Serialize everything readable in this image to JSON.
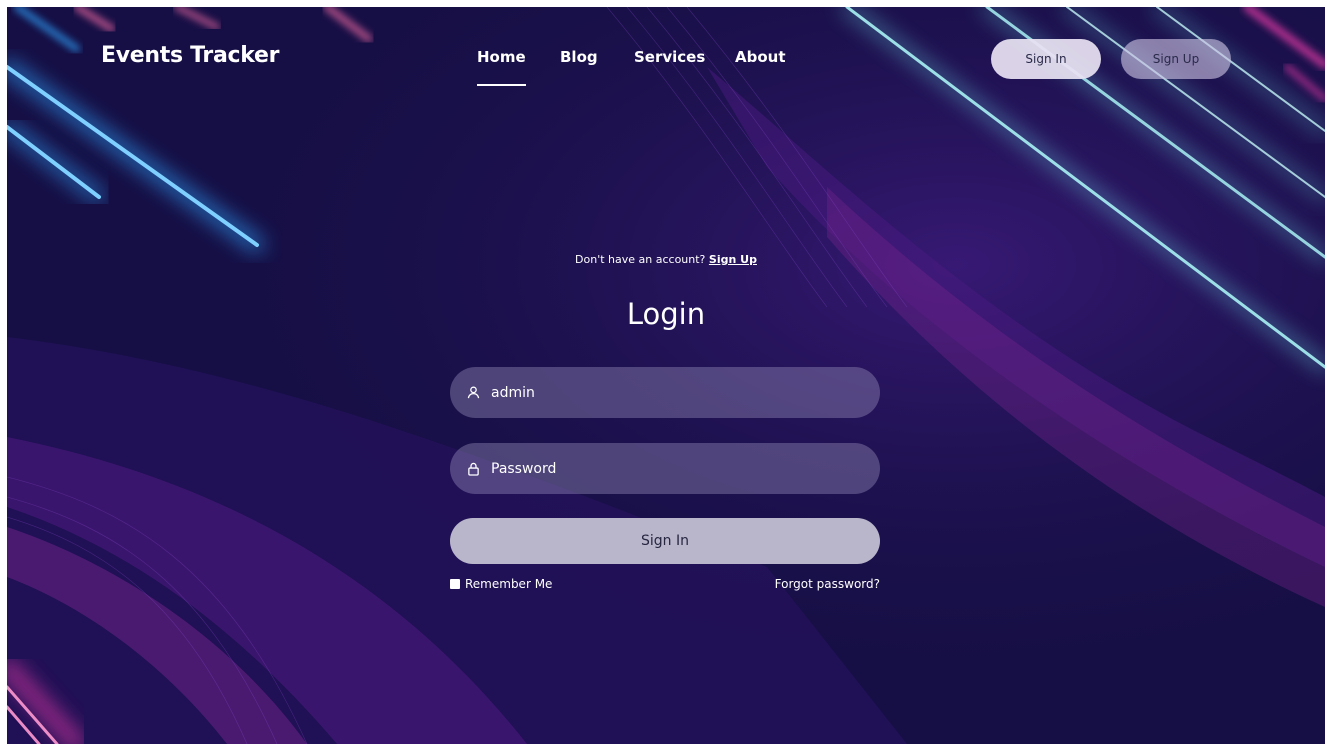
{
  "navbar": {
    "brand": "Events Tracker",
    "links": [
      {
        "label": "Home",
        "active": true
      },
      {
        "label": "Blog",
        "active": false
      },
      {
        "label": "Services",
        "active": false
      },
      {
        "label": "About",
        "active": false
      }
    ],
    "sign_in_label": "Sign In",
    "sign_up_label": "Sign Up"
  },
  "form": {
    "account_prompt": "Don't have an account?",
    "account_link": "Sign Up",
    "title": "Login",
    "username": {
      "value": "admin",
      "icon": "user-icon"
    },
    "password": {
      "value": "",
      "placeholder": "Password",
      "icon": "lock-icon"
    },
    "submit_label": "Sign In",
    "remember_label": "Remember Me",
    "forgot_label": "Forgot password?"
  },
  "colors": {
    "background": "#160f45",
    "neon_blue": "#2fa6ff",
    "neon_pink": "#e33aa6",
    "neon_cyan": "#6fe3ee",
    "button": "#b9b6cc"
  }
}
